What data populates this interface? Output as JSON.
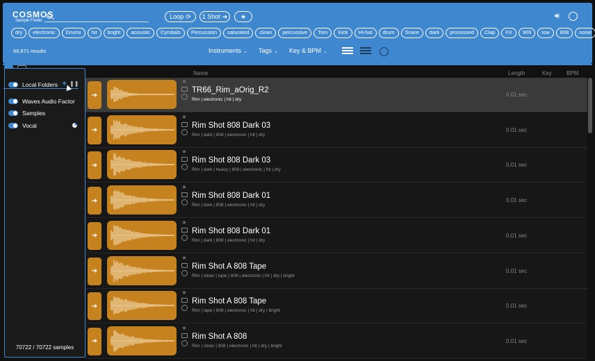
{
  "header": {
    "logo": "COSMOS",
    "logo_sub": "Sample Finder",
    "loop_label": "Loop",
    "oneshot_label": "1 Shot",
    "results": "69,871 results",
    "filters": [
      "Instruments",
      "Tags",
      "Key & BPM"
    ],
    "tags": [
      "dry",
      "electronic",
      "Drums",
      "hit",
      "bright",
      "acoustic",
      "Cymbals",
      "Percussion",
      "saturated",
      "clean",
      "percussive",
      "Tom",
      "Kick",
      "Hi-hat",
      "drum",
      "Snare",
      "dark",
      "processed",
      "Clap",
      "FX",
      "909",
      "low",
      "808",
      "noise"
    ]
  },
  "sidebar": {
    "items": [
      {
        "label": "Local Folders"
      },
      {
        "label": "Waves Audio Factor"
      },
      {
        "label": "Samples"
      },
      {
        "label": "Vocal"
      }
    ],
    "count": "70722 / 70722 samples"
  },
  "columns": {
    "name": "Name",
    "length": "Length",
    "key": "Key",
    "bpm": "BPM"
  },
  "rows": [
    {
      "title": "TR66_Rim_aOrig_R2",
      "tags": "Rim | electronic | hit | dry",
      "length": "0.01 sec"
    },
    {
      "title": "Rim Shot 808 Dark 03",
      "tags": "Rim | dark | 808 | electronic | hit | dry",
      "length": "0.01 sec"
    },
    {
      "title": "Rim Shot 808 Dark 03",
      "tags": "Rim | dark | heavy | 808 | electronic | hit | dry",
      "length": "0.01 sec"
    },
    {
      "title": "Rim Shot 808 Dark 01",
      "tags": "Rim | dark | 808 | electronic | hit | dry",
      "length": "0.01 sec"
    },
    {
      "title": "Rim Shot 808 Dark 01",
      "tags": "Rim | dark | 808 | electronic | hit | dry",
      "length": "0.01 sec"
    },
    {
      "title": "Rim Shot A 808 Tape",
      "tags": "Rim | clean | tape | 808 | electronic | hit | dry | bright",
      "length": "0.01 sec"
    },
    {
      "title": "Rim Shot A 808 Tape",
      "tags": "Rim | tape | 808 | electronic | hit | dry | bright",
      "length": "0.01 sec"
    },
    {
      "title": "Rim Shot A 808",
      "tags": "Rim | clean | 808 | electronic | hit | dry | bright",
      "length": "0.01 sec"
    }
  ],
  "colors": {
    "accent": "#3f87cf",
    "wave": "#c78220"
  }
}
